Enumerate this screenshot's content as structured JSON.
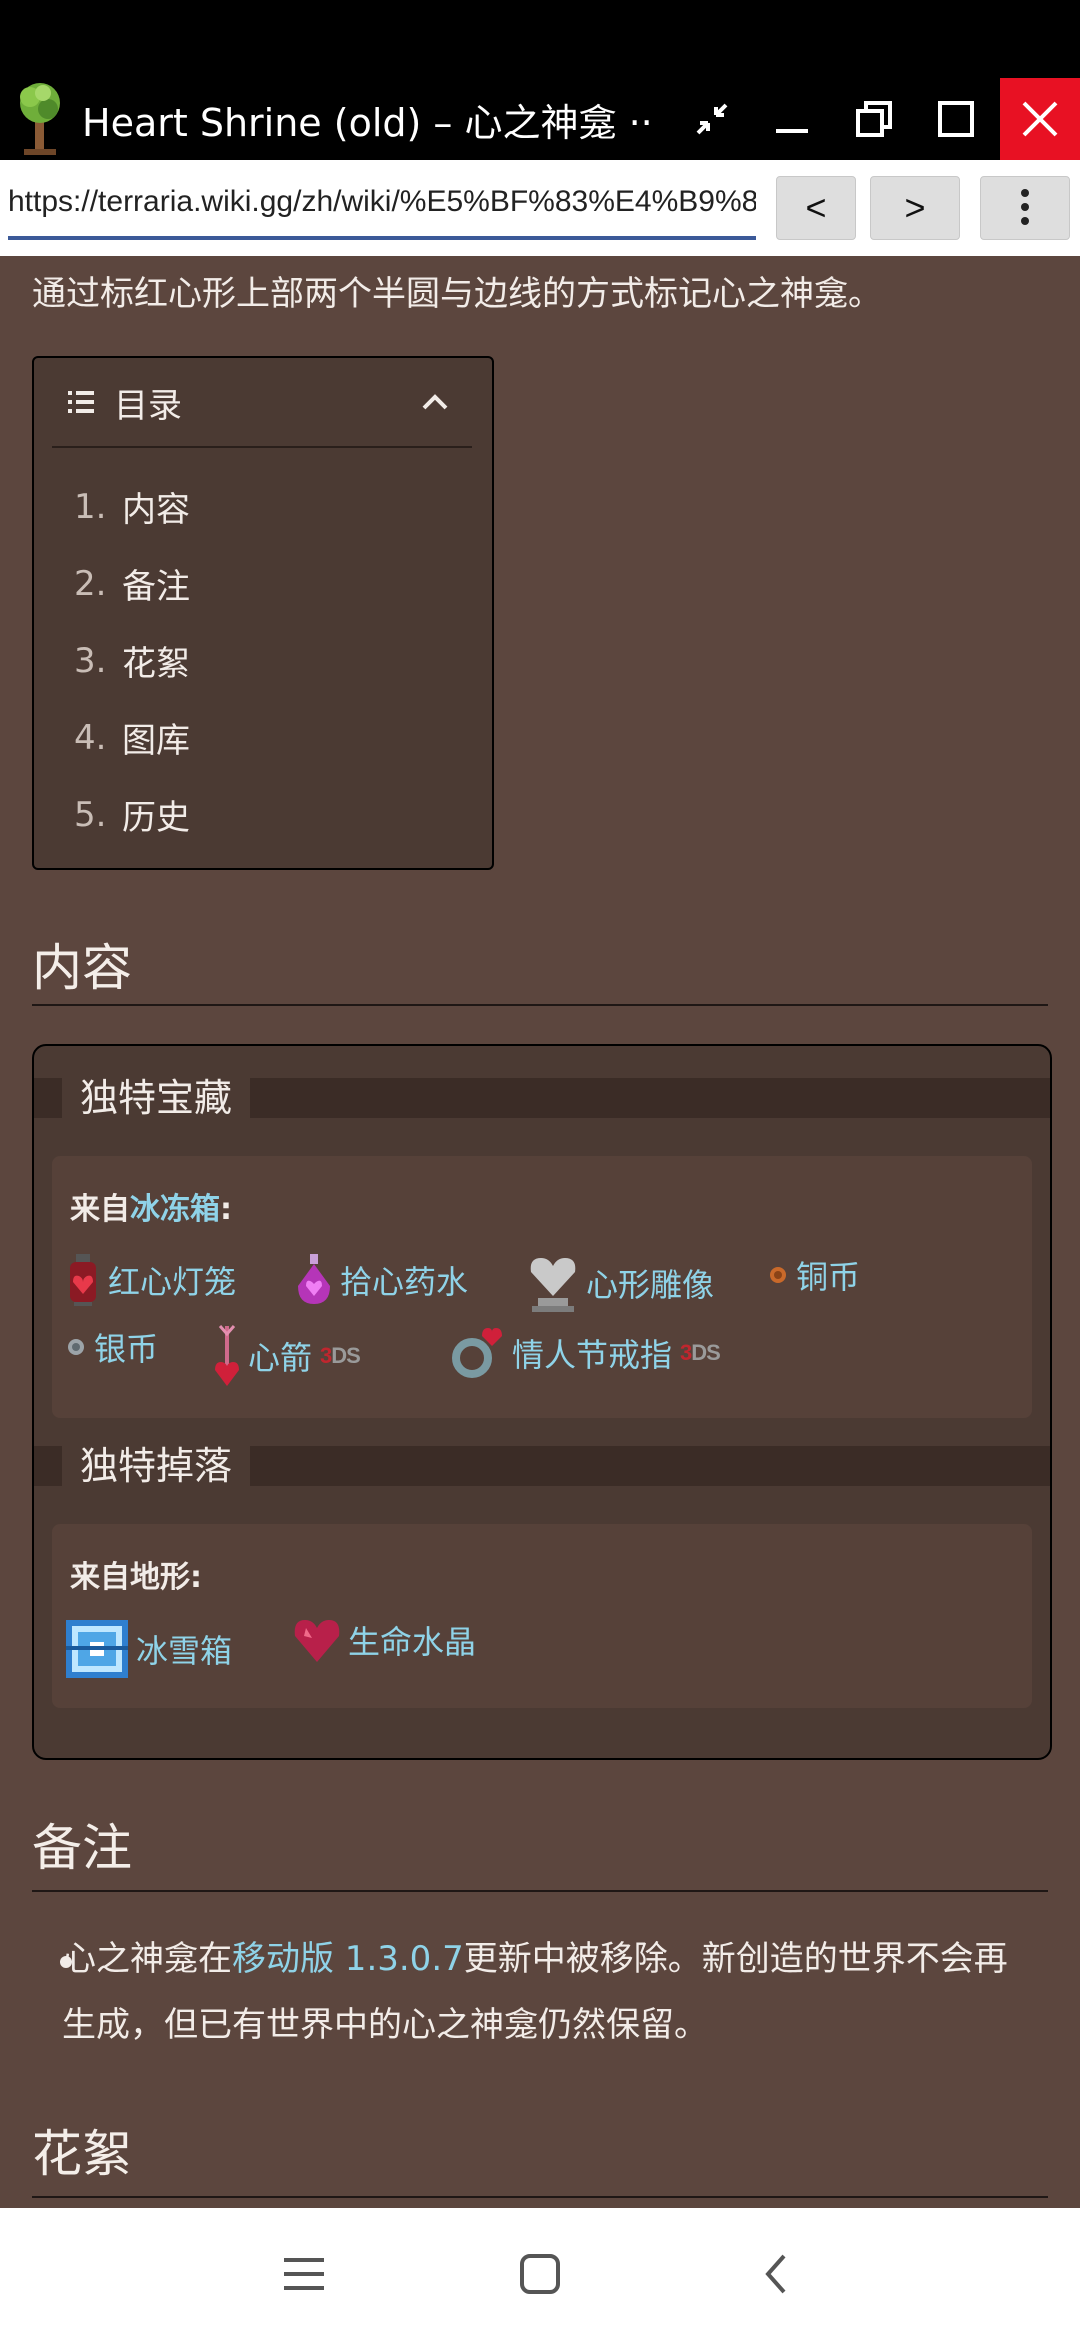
{
  "window": {
    "title": "Heart Shrine (old) – 心之神龛 ··",
    "url": "https://terraria.wiki.gg/zh/wiki/%E5%BF%83%E4%B9%8B%E",
    "back_label": "<",
    "forward_label": ">"
  },
  "article": {
    "intro": "通过标红心形上部两个半圆与边线的方式标记心之神龛。",
    "toc": {
      "title": "目录",
      "items": [
        {
          "num": "1.",
          "label": "内容"
        },
        {
          "num": "2.",
          "label": "备注"
        },
        {
          "num": "3.",
          "label": "花絮"
        },
        {
          "num": "4.",
          "label": "图库"
        },
        {
          "num": "5.",
          "label": "历史"
        }
      ]
    },
    "sections": {
      "contents": "内容",
      "notes": "备注",
      "trivia": "花絮"
    },
    "unique_treasure": {
      "title": "独特宝藏",
      "from_prefix": "来自",
      "from_link": "冰冻箱",
      "from_suffix": ":",
      "items": [
        "红心灯笼",
        "拾心药水",
        "心形雕像",
        "铜币",
        "银币",
        "心箭",
        "情人节戒指"
      ],
      "badge_3": "3",
      "badge_ds": "DS"
    },
    "unique_drops": {
      "title": "独特掉落",
      "from_label": "来自地形:",
      "items": [
        "冰雪箱",
        "生命水晶"
      ]
    },
    "note": {
      "before": "心之神龛在",
      "link": "移动版 1.3.0.7",
      "after": "更新中被移除。新创造的世界不会再生成，但已有世界中的心之神龛仍然保留。"
    }
  },
  "icons": {
    "minimize": "minimize-icon",
    "restore": "restore-icon",
    "maximize": "maximize-icon",
    "close": "close-icon",
    "collapse": "collapse-icon",
    "menu": "more-vert-icon"
  },
  "colors": {
    "page_bg": "#5c463e",
    "link": "#8fd3e8",
    "close": "#e81123"
  }
}
